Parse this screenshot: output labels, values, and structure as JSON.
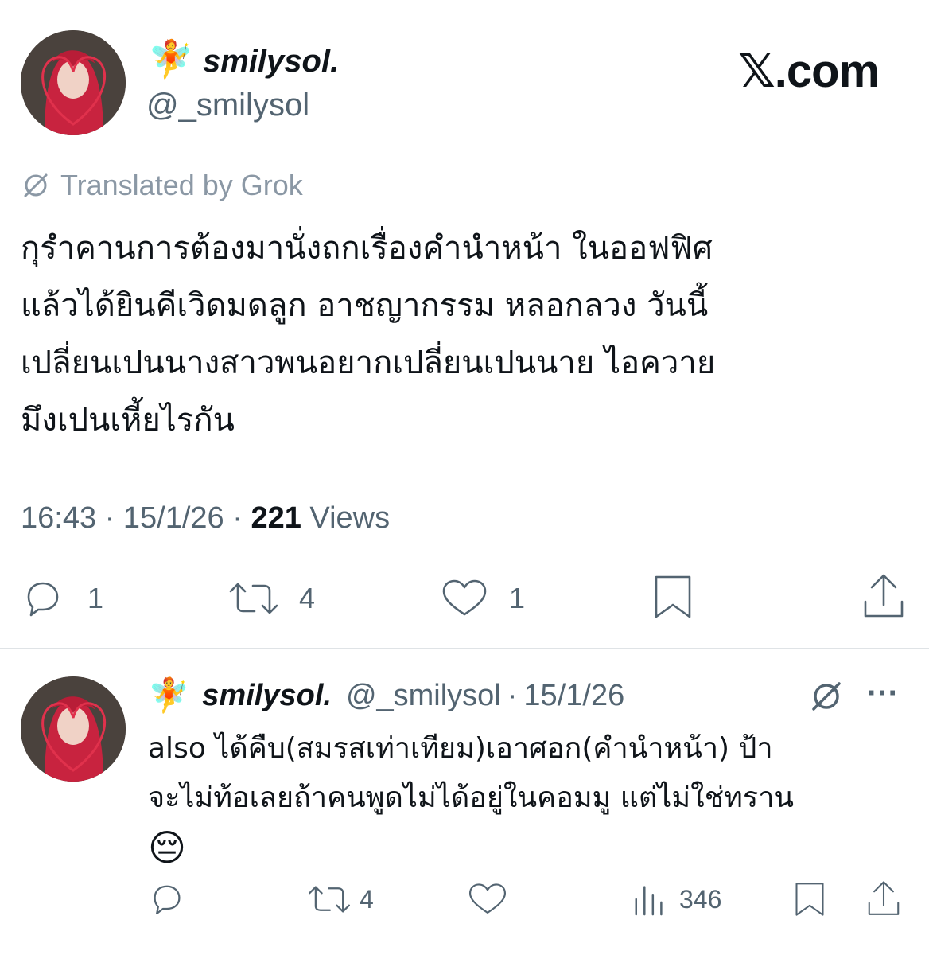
{
  "post": {
    "display_name": "smilysol.",
    "handle": "@_smilysol",
    "avatar_emoji": "🧚",
    "watermark": "𝕏.com",
    "translated_label": "Translated by Grok",
    "text_lines": [
      "กุรำคานการต้องมานั่งถกเรื่องคำนำหน้า ในออฟฟิศ",
      "แล้วได้ยินคีเวิดมดลูก อาชญากรรม หลอกลวง วันนี้",
      "เปลี่ยนเปนนางสาวพนอยากเปลี่ยนเปนนาย ไอควาย",
      "มึงเปนเหี้ยไรกัน"
    ],
    "time": "16:43",
    "sep": "·",
    "date": "15/1/26",
    "views_count": "221",
    "views_label": "Views",
    "actions": {
      "reply_count": "1",
      "repost_count": "4",
      "like_count": "1"
    }
  },
  "reply": {
    "display_name": "smilysol.",
    "handle": "@_smilysol",
    "sep": "·",
    "date": "15/1/26",
    "avatar_emoji": "🧚",
    "text_lines": [
      "also ได้คืบ(สมรสเท่าเทียม)เอาศอก(คำนำหน้า) ป้า",
      "จะไม่ท้อเลยถ้าคนพูดไม่ได้อยู่ในคอมมู แต่ไม่ใช่ทราน",
      "😔"
    ],
    "more_label": "···",
    "actions": {
      "reply_count": "",
      "repost_count": "4",
      "like_count": "",
      "views_count": "346"
    }
  },
  "colors": {
    "text": "#0f1419",
    "muted": "#536471",
    "divider": "#dfe3e6",
    "hair": "#c8233f"
  },
  "icons": [
    "fairy-icon",
    "grok-icon",
    "reply-icon",
    "repost-icon",
    "like-icon",
    "bookmark-icon",
    "share-icon",
    "views-icon",
    "more-icon"
  ]
}
